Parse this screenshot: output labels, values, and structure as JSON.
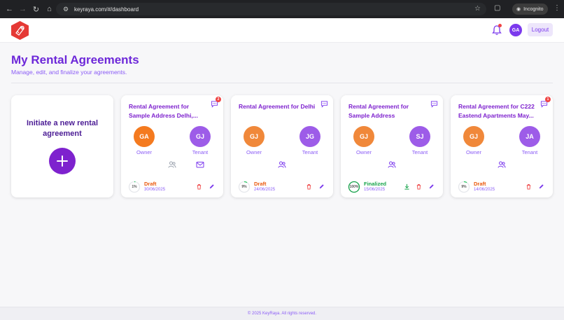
{
  "browser": {
    "url": "keyraya.com/#/dashboard",
    "incognito_label": "Incognito"
  },
  "header": {
    "user_initials": "GA",
    "logout_label": "Logout",
    "notification_unread": true
  },
  "page": {
    "title": "My Rental Agreements",
    "subtitle": "Manage, edit, and finalize your agreements."
  },
  "initiate": {
    "label": "Initiate a new rental agreement"
  },
  "roles": {
    "owner": "Owner",
    "tenant": "Tenant"
  },
  "agreements": [
    {
      "title": "Rental Agreement for Sample Address Delhi,...",
      "chat_badge": "2",
      "owner_initials": "GA",
      "tenant_initials": "GJ",
      "progress_label": "1%",
      "progress": 0.01,
      "status": "Draft",
      "date": "30/06/2025"
    },
    {
      "title": "Rental Agreement for Delhi",
      "chat_badge": "",
      "owner_initials": "GJ",
      "tenant_initials": "JG",
      "progress_label": "9%",
      "progress": 0.09,
      "status": "Draft",
      "date": "24/06/2025"
    },
    {
      "title": "Rental Agreement for Sample Address",
      "chat_badge": "",
      "owner_initials": "GJ",
      "tenant_initials": "SJ",
      "progress_label": "100%",
      "progress": 1.0,
      "status": "Finalized",
      "date": "15/06/2025"
    },
    {
      "title": "Rental Agreement for C222 Eastend Apartments May...",
      "chat_badge": "1",
      "owner_initials": "GJ",
      "tenant_initials": "JA",
      "progress_label": "9%",
      "progress": 0.09,
      "status": "Draft",
      "date": "14/06/2025"
    }
  ],
  "footer": {
    "text": "© 2025 KeyRaya. All rights reserved."
  },
  "colors": {
    "brand_purple": "#7e22ce",
    "draft": "#ea580c",
    "finalized": "#16a34a",
    "delete": "#ef4444"
  }
}
